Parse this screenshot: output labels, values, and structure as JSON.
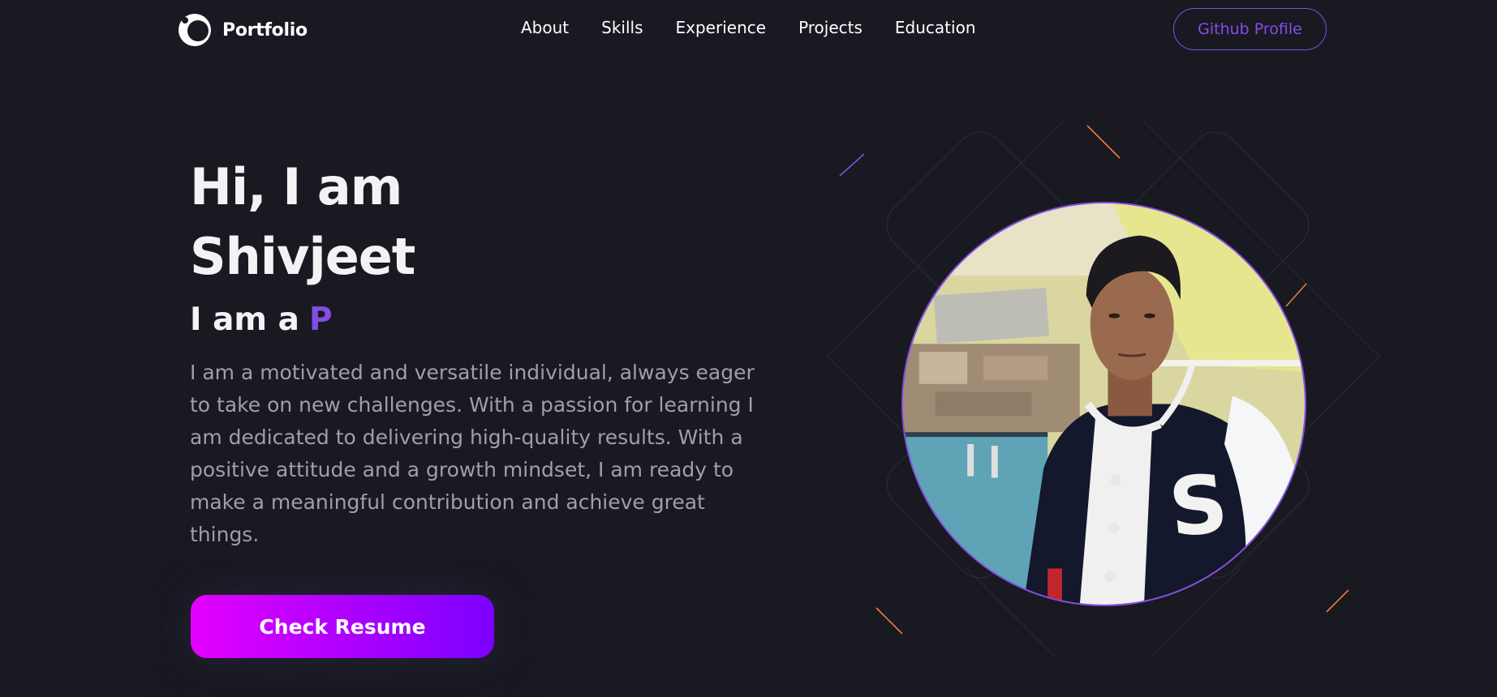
{
  "nav": {
    "logo_text": "Portfolio",
    "links": [
      "About",
      "Skills",
      "Experience",
      "Projects",
      "Education"
    ],
    "github_label": "Github Profile"
  },
  "hero": {
    "title_line1": "Hi, I am",
    "title_line2": "Shivjeet",
    "role_prefix": "I am a",
    "role_typed": "P",
    "description": "I am a motivated and versatile individual, always eager to take on new challenges. With a passion for learning I am dedicated to delivering high-quality results. With a positive attitude and a growth mindset, I am ready to make a meaningful contribution and achieve great things.",
    "resume_label": "Check Resume"
  },
  "colors": {
    "background": "#191922",
    "accent": "#854ce6",
    "text_primary": "#f2f3f4",
    "text_secondary": "#9f9fa6",
    "button_gradient_start": "#e400ff",
    "button_gradient_end": "#7c00ff"
  },
  "icons": {
    "logo": "crescent-logo-icon"
  }
}
